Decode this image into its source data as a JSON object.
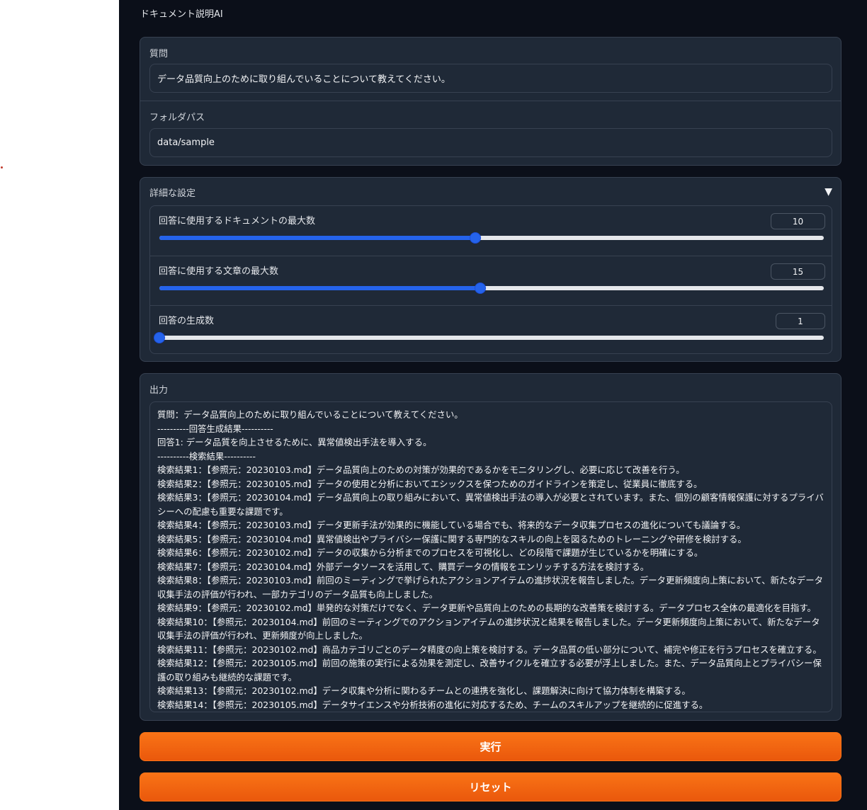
{
  "app": {
    "title": "ドキュメント説明AI"
  },
  "inputs": {
    "question": {
      "label": "質問",
      "value": "データ品質向上のために取り組んでいることについて教えてください。"
    },
    "folder": {
      "label": "フォルダパス",
      "value": "data/sample"
    }
  },
  "settings": {
    "title": "詳細な設定",
    "sliders": [
      {
        "label": "回答に使用するドキュメントの最大数",
        "value": "10",
        "fraction": 0.475
      },
      {
        "label": "回答に使用する文章の最大数",
        "value": "15",
        "fraction": 0.483
      },
      {
        "label": "回答の生成数",
        "value": "1",
        "fraction": 0.0
      }
    ]
  },
  "output": {
    "label": "出力",
    "text": "質問：データ品質向上のために取り組んでいることについて教えてください。\n----------回答生成結果----------\n回答1: データ品質を向上させるために、異常値検出手法を導入する。\n----------検索結果----------\n検索結果1：【参照元：20230103.md】データ品質向上のための対策が効果的であるかをモニタリングし、必要に応じて改善を行う。\n検索結果2：【参照元：20230105.md】データの使用と分析においてエシックスを保つためのガイドラインを策定し、従業員に徹底する。\n検索結果3：【参照元：20230104.md】データ品質向上の取り組みにおいて、異常値検出手法の導入が必要とされています。また、個別の顧客情報保護に対するプライバシーへの配慮も重要な課題です。\n検索結果4：【参照元：20230103.md】データ更新手法が効果的に機能している場合でも、将来的なデータ収集プロセスの進化についても議論する。\n検索結果5：【参照元：20230104.md】異常値検出やプライバシー保護に関する専門的なスキルの向上を図るためのトレーニングや研修を検討する。\n検索結果6：【参照元：20230102.md】データの収集から分析までのプロセスを可視化し、どの段階で課題が生じているかを明確にする。\n検索結果7：【参照元：20230104.md】外部データソースを活用して、購買データの情報をエンリッチする方法を検討する。\n検索結果8：【参照元：20230103.md】前回のミーティングで挙げられたアクションアイテムの進捗状況を報告しました。データ更新頻度向上策において、新たなデータ収集手法の評価が行われ、一部カテゴリのデータ品質も向上しました。\n検索結果9：【参照元：20230102.md】単発的な対策だけでなく、データ更新や品質向上のための長期的な改善策を検討する。データプロセス全体の最適化を目指す。\n検索結果10：【参照元：20230104.md】前回のミーティングでのアクションアイテムの進捗状況と結果を報告しました。データ更新頻度向上策において、新たなデータ収集手法の評価が行われ、更新頻度が向上しました。\n検索結果11：【参照元：20230102.md】商品カテゴリごとのデータ精度の向上策を検討する。データ品質の低い部分について、補完や修正を行うプロセスを確立する。\n検索結果12：【参照元：20230105.md】前回の施策の実行による効果を測定し、改善サイクルを確立する必要が浮上しました。また、データ品質向上とプライバシー保護の取り組みも継続的な課題です。\n検索結果13：【参照元：20230102.md】データ収集や分析に関わるチームとの連携を強化し、課題解決に向けて協力体制を構築する。\n検索結果14：【参照元：20230105.md】データサイエンスや分析技術の進化に対応するため、チームのスキルアップを継続的に促進する。"
  },
  "buttons": {
    "run": "実行",
    "reset": "リセット"
  },
  "colors": {
    "accent": "#2563eb",
    "button": "#f97316",
    "background": "#0b0f19",
    "panel": "#1f2937"
  }
}
